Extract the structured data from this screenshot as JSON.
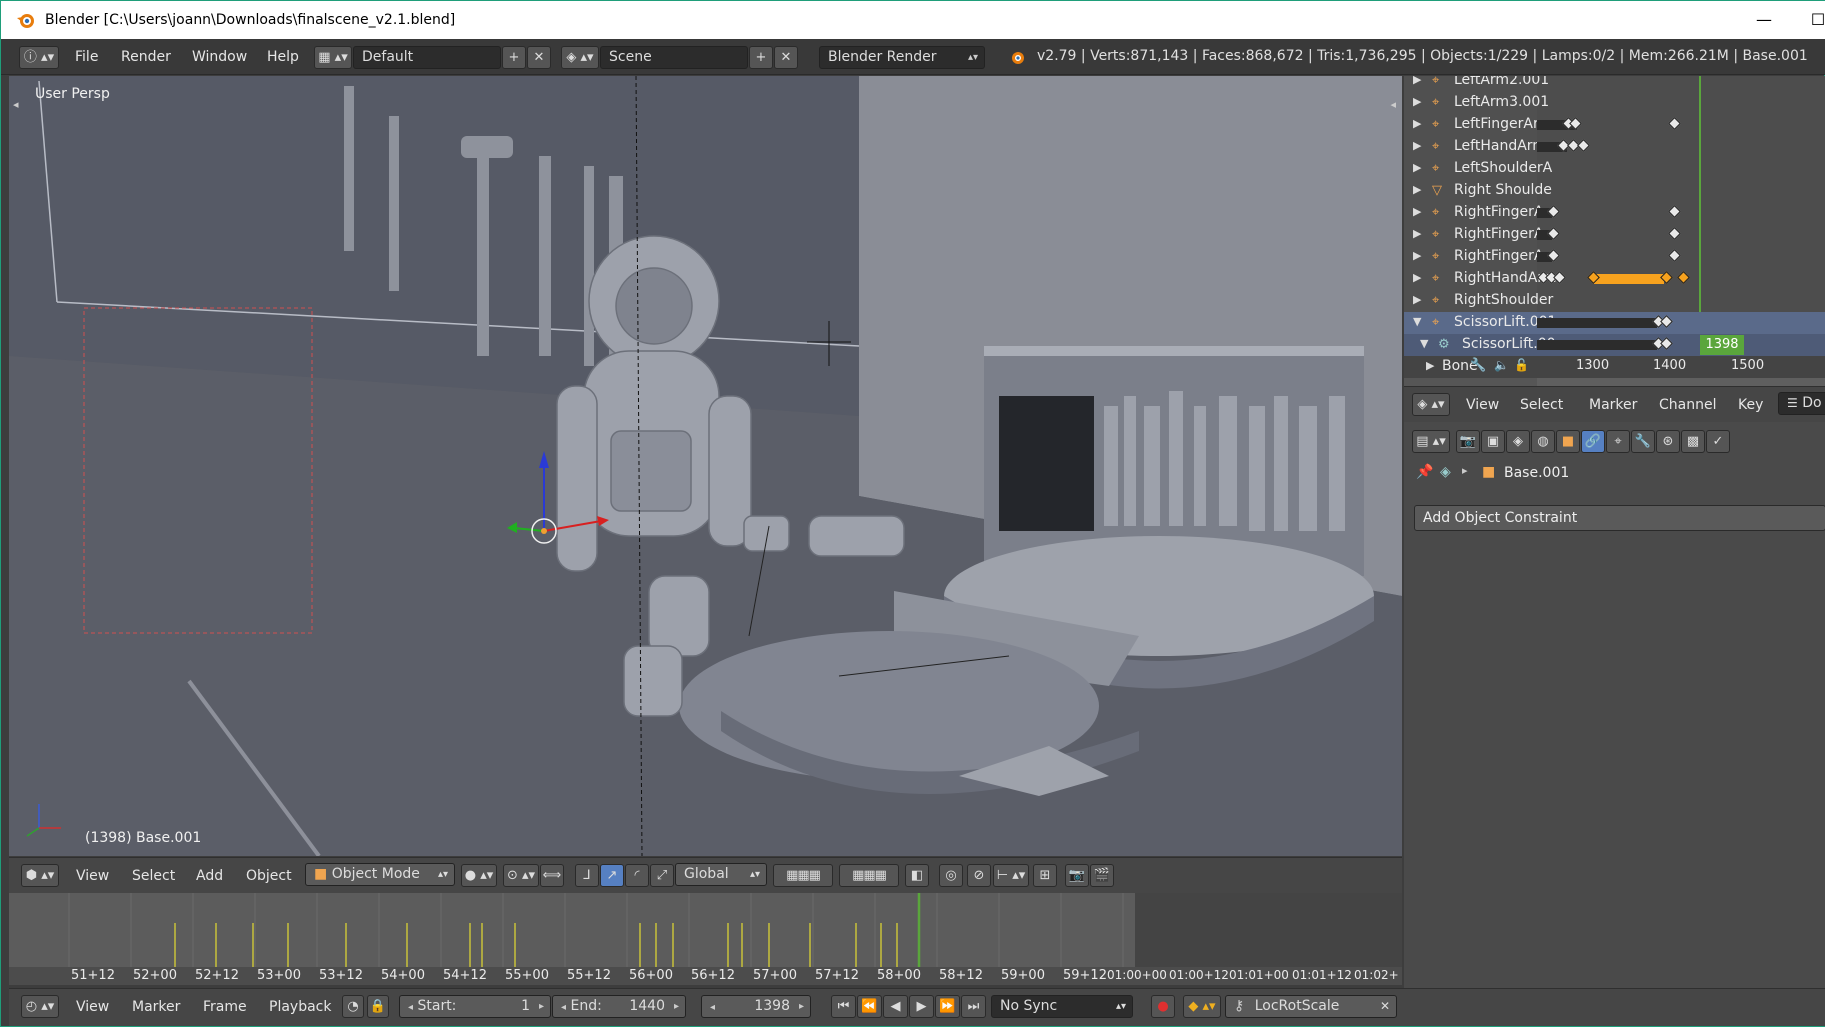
{
  "window": {
    "title": "Blender [C:\\Users\\joann\\Downloads\\finalscene_v2.1.blend]",
    "minimize": "—",
    "maximize": "☐"
  },
  "infobar": {
    "menus": [
      "File",
      "Render",
      "Window",
      "Help"
    ],
    "layout": "Default",
    "scene": "Scene",
    "engine": "Blender Render",
    "stats": "v2.79 | Verts:871,143 | Faces:868,672 | Tris:1,736,295 | Objects:1/229 | Lamps:0/2 | Mem:266.21M | Base.001"
  },
  "viewport": {
    "view_name": "User Persp",
    "object_info": "(1398) Base.001",
    "header": {
      "menus": [
        "View",
        "Select",
        "Add",
        "Object"
      ],
      "mode": "Object Mode",
      "orientation": "Global"
    }
  },
  "timeline": {
    "ticks": [
      "51+12",
      "52+00",
      "52+12",
      "53+00",
      "53+12",
      "54+00",
      "54+12",
      "55+00",
      "55+12",
      "56+00",
      "56+12",
      "57+00",
      "57+12",
      "58+00",
      "58+12",
      "59+00",
      "59+12",
      "01:00+00",
      "01:00+12",
      "01:01+00",
      "01:01+12",
      "01:02+"
    ],
    "header": {
      "menus": [
        "View",
        "Marker",
        "Frame",
        "Playback"
      ],
      "start_label": "Start:",
      "start_value": "1",
      "end_label": "End:",
      "end_value": "1440",
      "current_frame": "1398",
      "sync": "No Sync",
      "keying_set": "LocRotScale"
    }
  },
  "outliner": {
    "rows": [
      {
        "label": "LeftArm2.001",
        "icon": "armature-icon"
      },
      {
        "label": "LeftArm3.001",
        "icon": "armature-icon"
      },
      {
        "label": "LeftFingerArm",
        "icon": "armature-icon"
      },
      {
        "label": "LeftHandArm.",
        "icon": "armature-icon"
      },
      {
        "label": "LeftShoulderA",
        "icon": "armature-icon"
      },
      {
        "label": "Right Shoulde",
        "icon": "mesh-icon"
      },
      {
        "label": "RightFingerAr",
        "icon": "armature-icon"
      },
      {
        "label": "RightFingerAr",
        "icon": "armature-icon"
      },
      {
        "label": "RightFingerAr",
        "icon": "armature-icon"
      },
      {
        "label": "RightHandArm",
        "icon": "armature-icon"
      },
      {
        "label": "RightShoulder",
        "icon": "armature-icon"
      },
      {
        "label": "ScissorLift.001",
        "icon": "armature-icon"
      },
      {
        "label": "ScissorLift.00",
        "icon": "action-icon"
      },
      {
        "label": "Bone",
        "icon": "bone-icon"
      }
    ],
    "current_frame_badge": "1398",
    "ruler": [
      "1300",
      "1400",
      "1500"
    ]
  },
  "dopesheet": {
    "menus": [
      "View",
      "Select",
      "Marker",
      "Channel",
      "Key"
    ],
    "mode_cut": "Do"
  },
  "properties": {
    "object_name": "Base.001",
    "add_constraint": "Add Object Constraint"
  },
  "colors": {
    "accent_orange": "#f7a21e",
    "frame_green": "#5aa63c",
    "viewport_bg": "#555962"
  }
}
